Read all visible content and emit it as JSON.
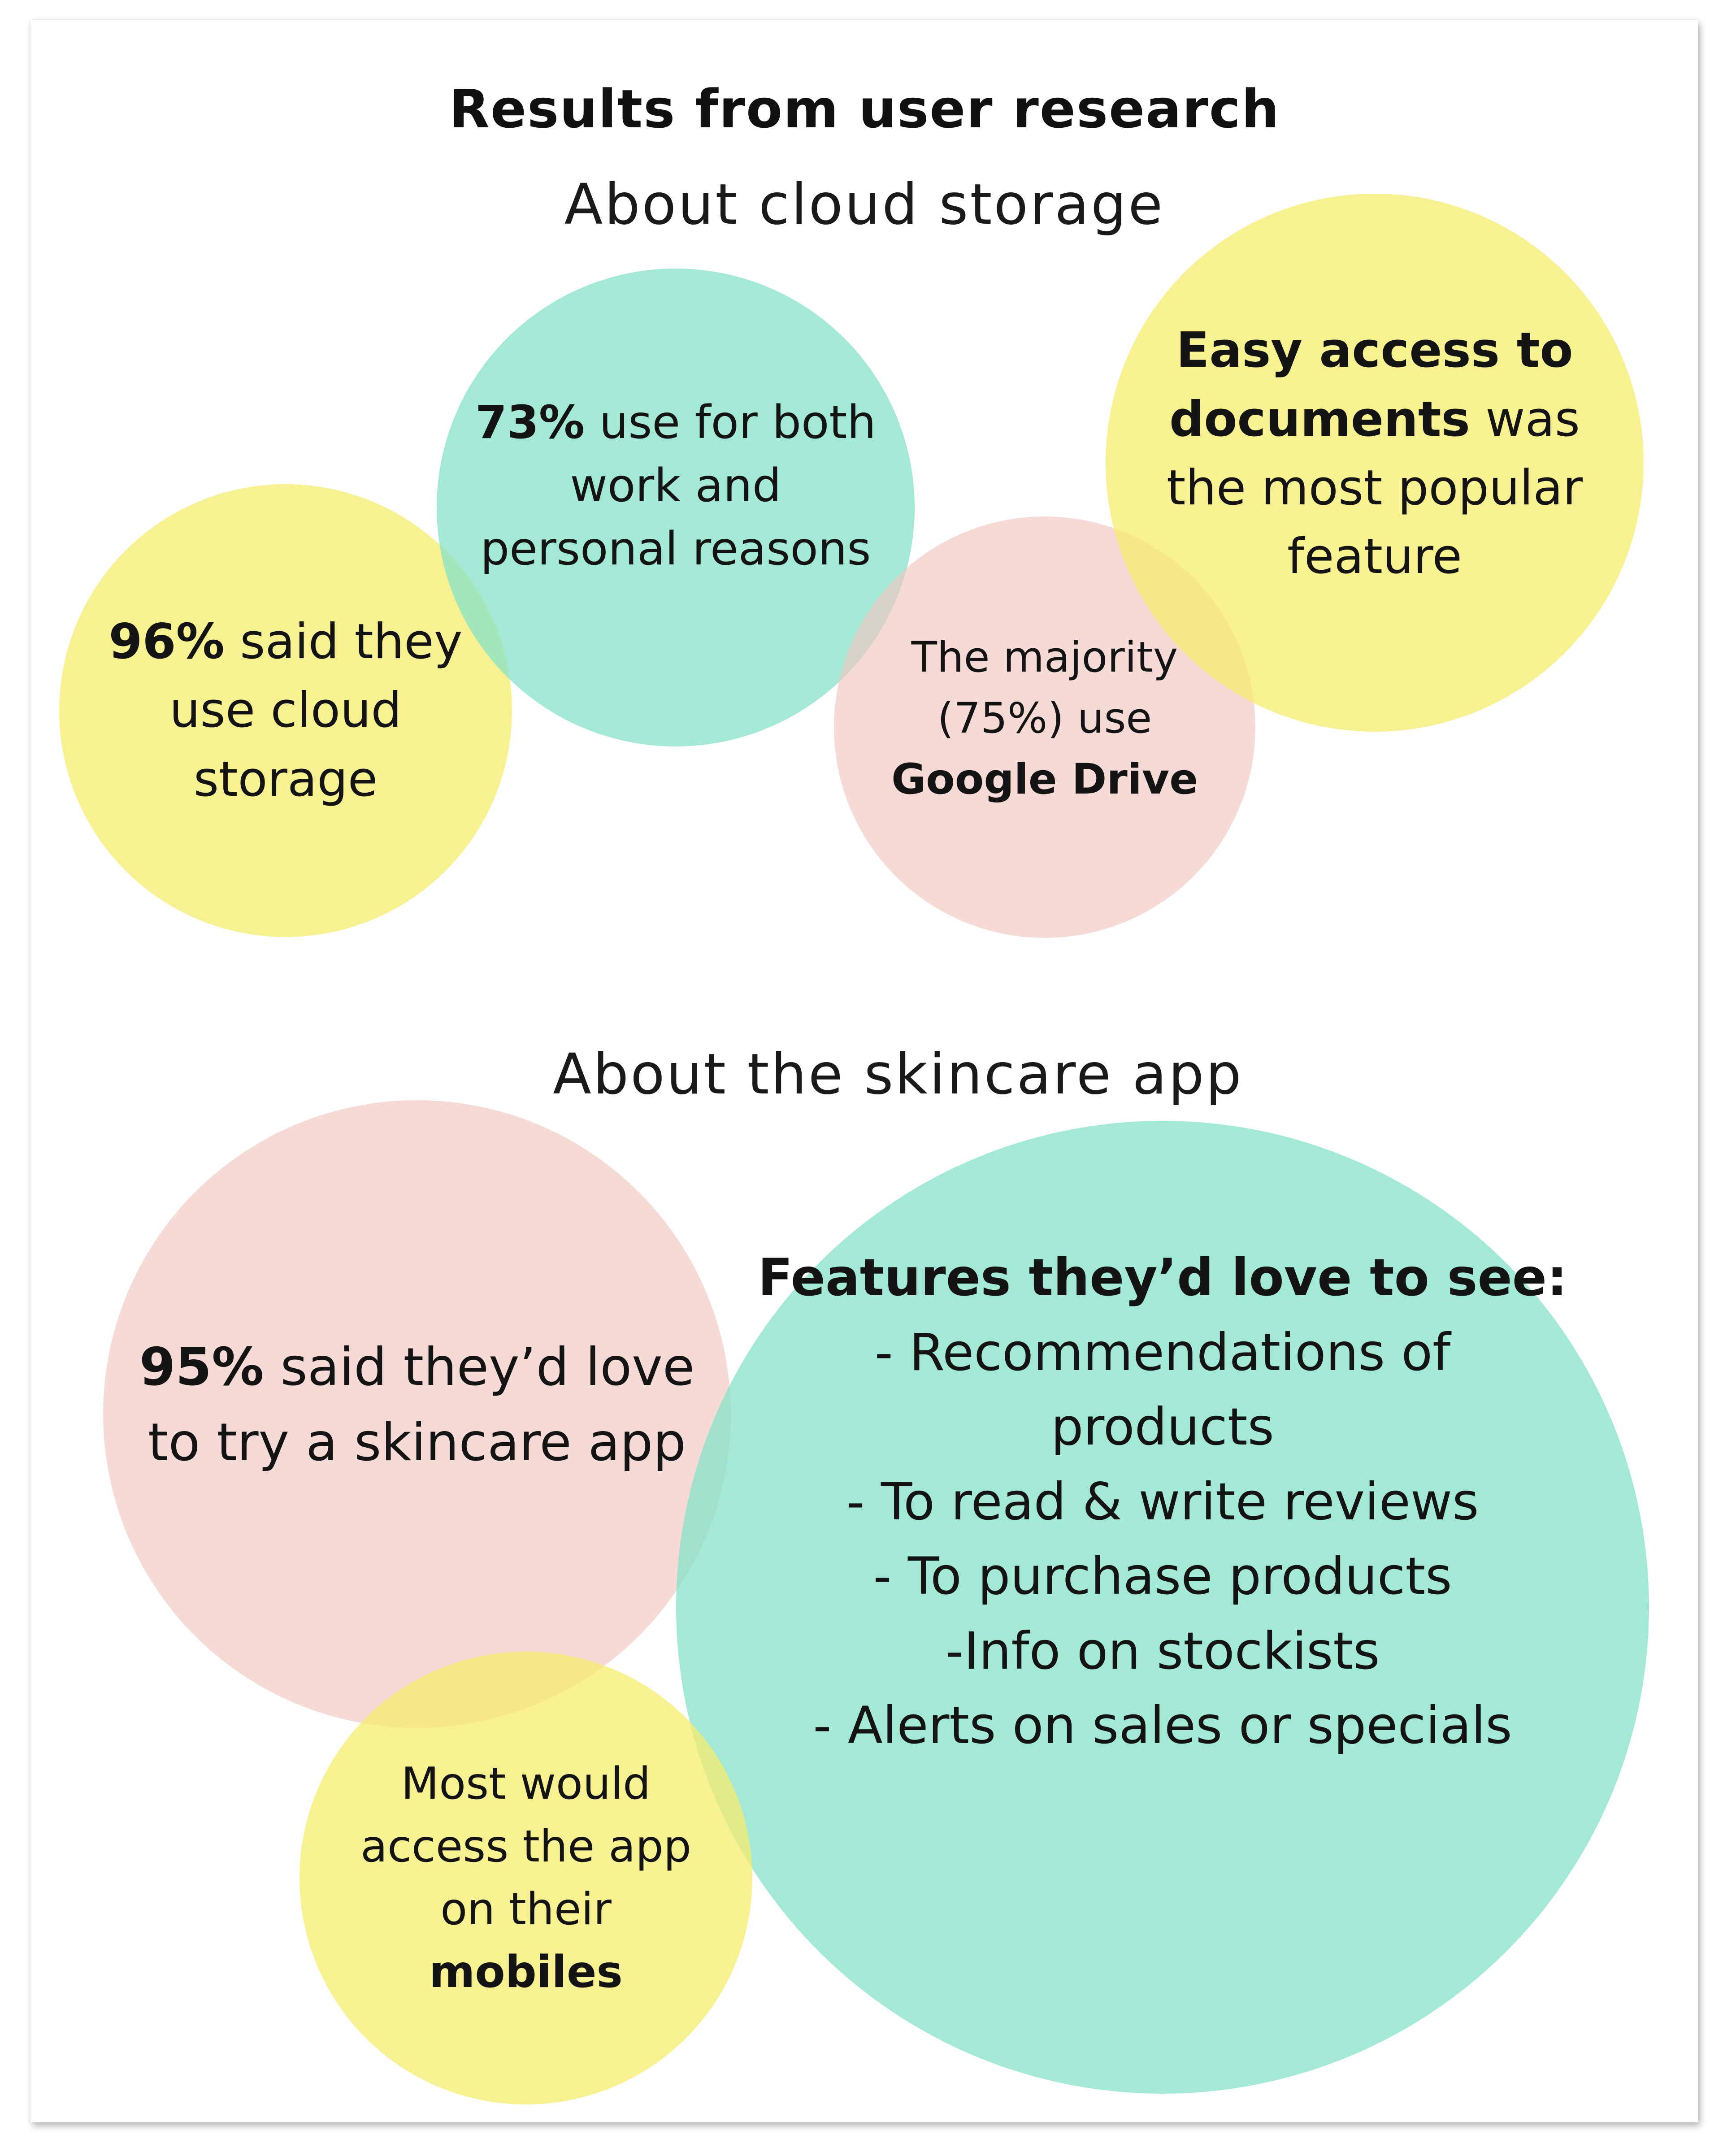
{
  "title": "Results from user research",
  "sections": {
    "cloud_heading": "About cloud storage",
    "skin_heading": "About the skincare app"
  },
  "colors": {
    "yellow_bubble": "#F5EC6E",
    "mint_bubble": "#84E1C8",
    "pink_bubble": "#F1C6BE"
  },
  "cloud": {
    "b96": {
      "bold": "96%",
      "rest": " said they",
      "line2": "use cloud",
      "line3": "storage"
    },
    "b73": {
      "bold": "73%",
      "rest": " use for both",
      "line2": "work and",
      "line3": "personal reasons"
    },
    "google": {
      "line1": "The majority",
      "line2": "(75%) use",
      "bold": "Google Drive"
    },
    "easy": {
      "bold1": "Easy access to",
      "bold2": "documents",
      "rest2": " was",
      "line3": "the most popular",
      "line4": "feature"
    }
  },
  "skin": {
    "b95": {
      "bold": "95%",
      "rest": " said they’d love",
      "line2": "to try a skincare app"
    },
    "features": {
      "heading": "Features they’d love to see:",
      "items": [
        "- Recommendations of",
        "products",
        "- To read & write reviews",
        "- To purchase products",
        "-Info on stockists",
        "- Alerts on sales or specials"
      ]
    },
    "mobile": {
      "line1": "Most would",
      "line2": "access the app",
      "line3": "on their",
      "bold": "mobiles"
    }
  }
}
